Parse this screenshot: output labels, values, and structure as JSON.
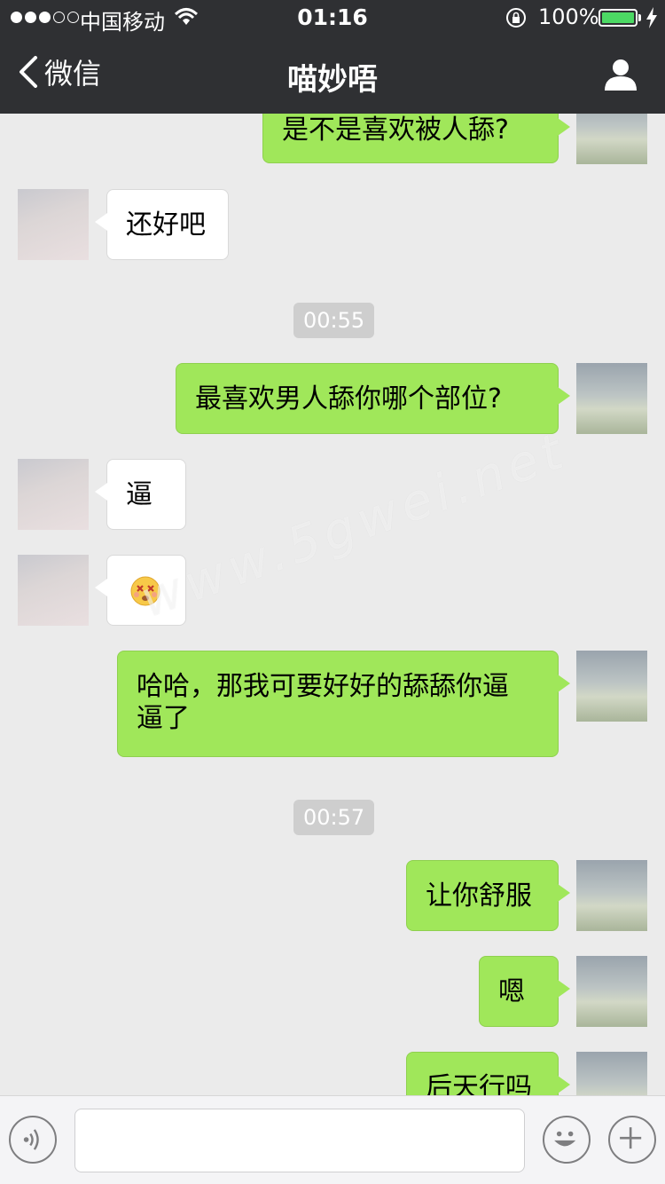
{
  "status_bar": {
    "carrier": "中国移动",
    "time": "01:16",
    "battery": "100%"
  },
  "nav": {
    "back_label": "微信",
    "title": "喵妙唔"
  },
  "messages": [
    {
      "from": "me",
      "text": "是不是喜欢被人舔?"
    },
    {
      "from": "her",
      "text": "还好吧"
    },
    {
      "type": "time",
      "text": "00:55"
    },
    {
      "from": "me",
      "text": "最喜欢男人舔你哪个部位?"
    },
    {
      "from": "her",
      "text": "逼"
    },
    {
      "from": "her",
      "emoji": "dizzy-face-emoji"
    },
    {
      "from": "me",
      "line1": "哈哈，那我可要好好的舔舔你逼",
      "line2": "逼了"
    },
    {
      "type": "time",
      "text": "00:57"
    },
    {
      "from": "me",
      "text": "让你舒服"
    },
    {
      "from": "me",
      "text": "嗯"
    },
    {
      "from": "me",
      "text": "后天行吗"
    }
  ],
  "watermark": "www.5gwei.net",
  "icons": {
    "back": "chevron-left-icon",
    "profile": "person-icon",
    "voice": "voice-icon",
    "emoji": "smiley-icon",
    "more": "plus-icon"
  },
  "colors": {
    "nav_bg": "#2f3033",
    "chat_bg": "#ebebeb",
    "my_bubble": "#a0e75a",
    "their_bubble": "#ffffff",
    "battery": "#4cd964"
  }
}
